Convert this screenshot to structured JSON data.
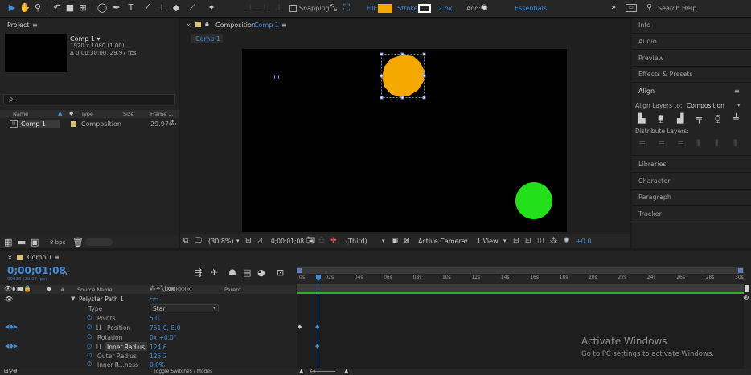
{
  "toolbar": {
    "snapping_label": "Snapping",
    "fill_label": "Fill:",
    "fill_color": "#f5a800",
    "stroke_label": "Stroke:",
    "stroke_width": "2 px",
    "add_label": "Add:",
    "workspace": "Essentials",
    "more": "»",
    "search_placeholder": "Search Help"
  },
  "project": {
    "title": "Project",
    "menu": "≡",
    "comp_name": "Comp 1 ▾",
    "comp_size": "1920 x 1080 (1.00)",
    "comp_duration": "Δ 0;00;30;00, 29.97 fps",
    "search_placeholder": "ρ.",
    "columns": {
      "name": "Name",
      "type": "Type",
      "size": "Size",
      "frame": "Frame ..."
    },
    "row": {
      "name": "Comp 1",
      "type": "Composition",
      "fps": "29.97"
    },
    "bpc": "8 bpc"
  },
  "composition": {
    "tab_label": "Composition",
    "tab_comp": "Comp 1",
    "tab_menu": "≡",
    "breadcrumb": "Comp 1",
    "zoom": "(30.8%)",
    "timecode": "0;00;01;08",
    "resolution": "(Third)",
    "camera": "Active Camera",
    "views": "1 View",
    "exposure": "+0.0"
  },
  "right_panels": {
    "items_top": [
      "Info",
      "Audio",
      "Preview",
      "Effects & Presets"
    ],
    "align_title": "Align",
    "align_menu": "≡",
    "align_layers_to_label": "Align Layers to:",
    "align_layers_to_value": "Composition",
    "distribute_label": "Distribute Layers:",
    "items_bottom": [
      "Libraries",
      "Character",
      "Paragraph",
      "Tracker"
    ]
  },
  "timeline": {
    "tab_label": "Comp 1",
    "tab_menu": "≡",
    "timecode": "0;00;01;08",
    "frame_info": "00038 (29.97 fps)",
    "search_placeholder": "ρ.",
    "col_source_name": "Source Name",
    "col_parent": "Parent",
    "col_hash": "#",
    "properties": [
      {
        "name": "Polystar Path 1",
        "value": ""
      },
      {
        "name": "Type",
        "value": "Star"
      },
      {
        "name": "Points",
        "value": "5.0"
      },
      {
        "name": "Rotation",
        "value": "0x +0.0°"
      },
      {
        "name": "Position",
        "value": "751.0,-8.0"
      },
      {
        "name": "Inner Radius",
        "value": "124.6"
      },
      {
        "name": "Outer Radius",
        "value": "125.2"
      },
      {
        "name": "Inner R...ness",
        "value": "0.0%"
      }
    ],
    "ruler_labels": [
      "0s",
      "02s",
      "04s",
      "06s",
      "08s",
      "10s",
      "12s",
      "14s",
      "16s",
      "18s",
      "20s",
      "22s",
      "24s",
      "26s",
      "28s",
      "30s"
    ],
    "toggle_label": "Toggle Switches / Modes"
  },
  "watermark": {
    "title": "Activate Windows",
    "subtitle": "Go to PC settings to activate Windows."
  },
  "colors": {
    "orange_shape": "#f5a800",
    "green_shape": "#22e01a",
    "accent": "#3f8ddb"
  }
}
